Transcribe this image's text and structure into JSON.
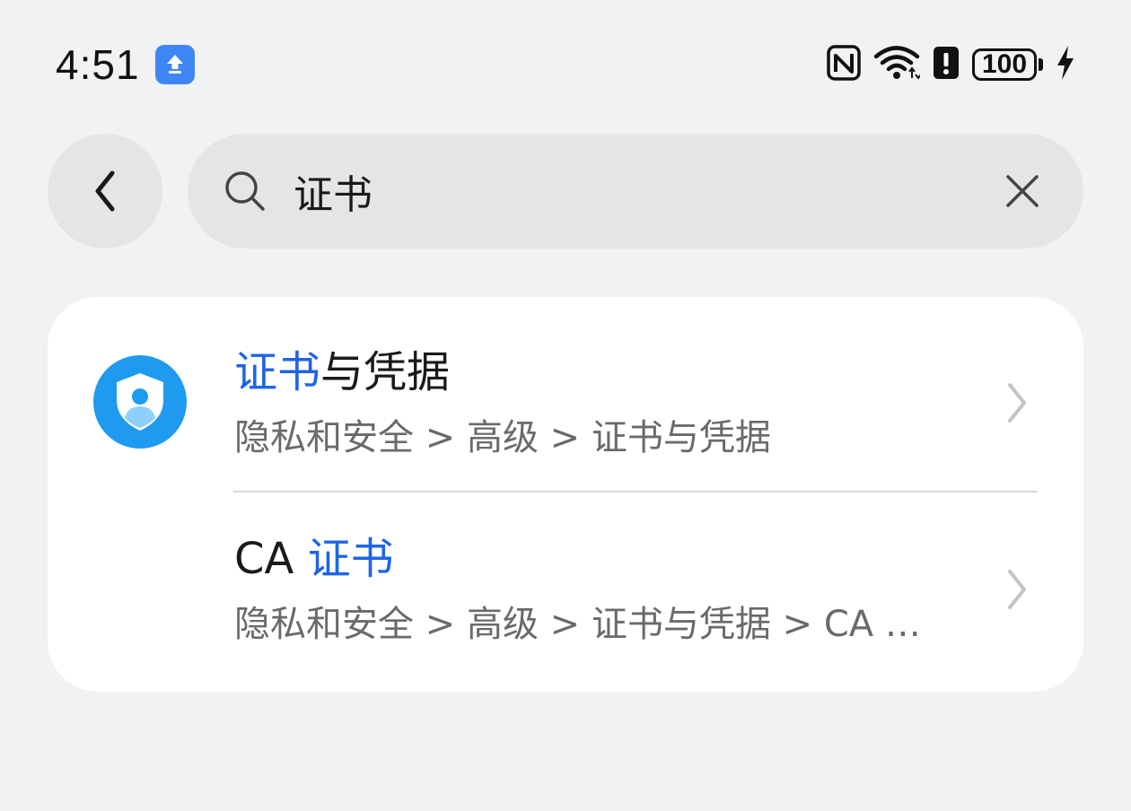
{
  "status_bar": {
    "time": "4:51",
    "battery_level": "100",
    "notification_icon": "upload-arrow-icon",
    "icons": [
      "nfc-icon",
      "wifi-icon",
      "alert-icon",
      "battery-icon",
      "charging-bolt-icon"
    ]
  },
  "search": {
    "query": "证书",
    "back_icon": "chevron-left-icon",
    "search_icon": "search-icon",
    "clear_icon": "close-icon"
  },
  "results": [
    {
      "title_highlight": "证书",
      "title_rest": "与凭据",
      "path": "隐私和安全 > 高级 > 证书与凭据",
      "icon": "shield-user-icon"
    },
    {
      "title_prefix": "CA ",
      "title_highlight": "证书",
      "path": "隐私和安全 > 高级 > 证书与凭据 > CA …",
      "icon": ""
    }
  ],
  "colors": {
    "background": "#f1f2f4",
    "highlight": "#1f64e6",
    "secondary_text": "#6a6a6a",
    "card": "#ffffff",
    "control_bg": "#e4e5e7",
    "icon_blue": "#1e9bf0"
  }
}
